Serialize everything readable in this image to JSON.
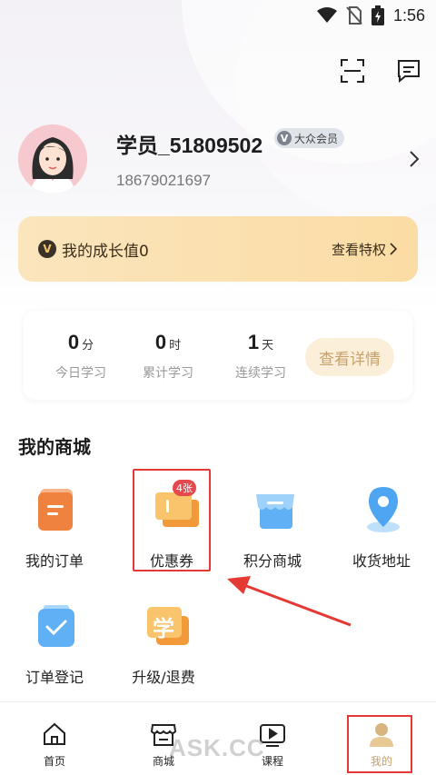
{
  "status_bar": {
    "time": "1:56"
  },
  "header": {
    "scan_icon": "scan-icon",
    "message_icon": "message-icon"
  },
  "profile": {
    "username": "学员_51809502",
    "badge": "大众会员",
    "badge_letter": "V",
    "phone": "18679021697"
  },
  "growth": {
    "letter": "V",
    "label": "我的成长值0",
    "link": "查看特权"
  },
  "stats": {
    "items": [
      {
        "value": "0",
        "unit": "分",
        "label": "今日学习"
      },
      {
        "value": "0",
        "unit": "时",
        "label": "累计学习"
      },
      {
        "value": "1",
        "unit": "天",
        "label": "连续学习"
      }
    ],
    "detail_button": "查看详情"
  },
  "mall": {
    "title": "我的商城",
    "items": [
      {
        "label": "我的订单",
        "icon": "order-icon"
      },
      {
        "label": "优惠券",
        "icon": "coupon-icon",
        "badge": "4张"
      },
      {
        "label": "积分商城",
        "icon": "points-store-icon"
      },
      {
        "label": "收货地址",
        "icon": "location-icon"
      },
      {
        "label": "订单登记",
        "icon": "order-register-icon"
      },
      {
        "label": "升级/退费",
        "icon": "upgrade-refund-icon",
        "glyph": "学"
      }
    ]
  },
  "bottom_nav": {
    "items": [
      {
        "label": "首页",
        "icon": "home-icon"
      },
      {
        "label": "商城",
        "icon": "store-icon"
      },
      {
        "label": "课程",
        "icon": "video-icon"
      },
      {
        "label": "我的",
        "icon": "profile-icon",
        "active": true
      }
    ]
  },
  "watermark": "ASK.CC",
  "colors": {
    "accent": "#c8a06a",
    "growth_bg": "#fbe0ae",
    "highlight": "#e53935",
    "badge_red": "#e5484d"
  }
}
